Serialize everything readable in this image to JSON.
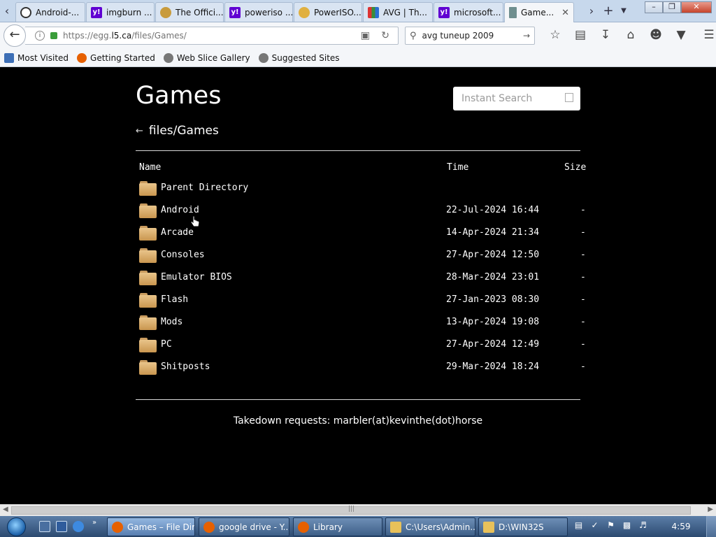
{
  "tabs": [
    {
      "label": "Android-...",
      "icon": "circle-logo-icon",
      "color": "#333333"
    },
    {
      "label": "imgburn ...",
      "icon": "yahoo-icon",
      "color": "#6001d2"
    },
    {
      "label": "The Offici...",
      "icon": "disc-icon",
      "color": "#c89b3c"
    },
    {
      "label": "poweriso ...",
      "icon": "yahoo-icon",
      "color": "#6001d2"
    },
    {
      "label": "PowerISO...",
      "icon": "disc-icon",
      "color": "#e0b040"
    },
    {
      "label": "AVG | Th...",
      "icon": "avg-icon",
      "color": "#3a8d3a"
    },
    {
      "label": "microsoft...",
      "icon": "yahoo-icon",
      "color": "#6001d2"
    },
    {
      "label": "Game...",
      "icon": "page-icon",
      "color": "#6f8f8f"
    }
  ],
  "navbar": {
    "url_prefix": "https://egg.",
    "url_domain": "l5.ca",
    "url_path": "/files/Games/",
    "search_value": "avg tuneup 2009"
  },
  "bookmarks": [
    {
      "label": "Most Visited",
      "color": "#3d6fb6"
    },
    {
      "label": "Getting Started",
      "color": "#e66000"
    },
    {
      "label": "Web Slice Gallery",
      "color": "#777777"
    },
    {
      "label": "Suggested Sites",
      "color": "#777777"
    }
  ],
  "page": {
    "title": "Games",
    "search_placeholder": "Instant Search",
    "back_arrow": "←",
    "breadcrumb": "files/Games",
    "columns": {
      "name": "Name",
      "time": "Time",
      "size": "Size"
    },
    "rows": [
      {
        "name": "Parent Directory",
        "time": "",
        "size": ""
      },
      {
        "name": "Android",
        "time": "22-Jul-2024 16:44",
        "size": "-"
      },
      {
        "name": "Arcade",
        "time": "14-Apr-2024 21:34",
        "size": "-"
      },
      {
        "name": "Consoles",
        "time": "27-Apr-2024 12:50",
        "size": "-"
      },
      {
        "name": "Emulator BIOS",
        "time": "28-Mar-2024 23:01",
        "size": "-"
      },
      {
        "name": "Flash",
        "time": "27-Jan-2023 08:30",
        "size": "-"
      },
      {
        "name": "Mods",
        "time": "13-Apr-2024 19:08",
        "size": "-"
      },
      {
        "name": "PC",
        "time": "27-Apr-2024 12:49",
        "size": "-"
      },
      {
        "name": "Shitposts",
        "time": "29-Mar-2024 18:24",
        "size": "-"
      }
    ],
    "footer": "Takedown requests: marbler(at)kevinthe(dot)horse"
  },
  "taskbar": {
    "tasks": [
      {
        "label": "Games – File Dir...",
        "color": "#e66000"
      },
      {
        "label": "google drive - Y...",
        "color": "#e66000"
      },
      {
        "label": "Library",
        "color": "#e66000"
      },
      {
        "label": "C:\\Users\\Admin...",
        "color": "#e8c15a"
      },
      {
        "label": "D:\\WIN32S",
        "color": "#e8c15a"
      }
    ],
    "clock": "4:59"
  }
}
